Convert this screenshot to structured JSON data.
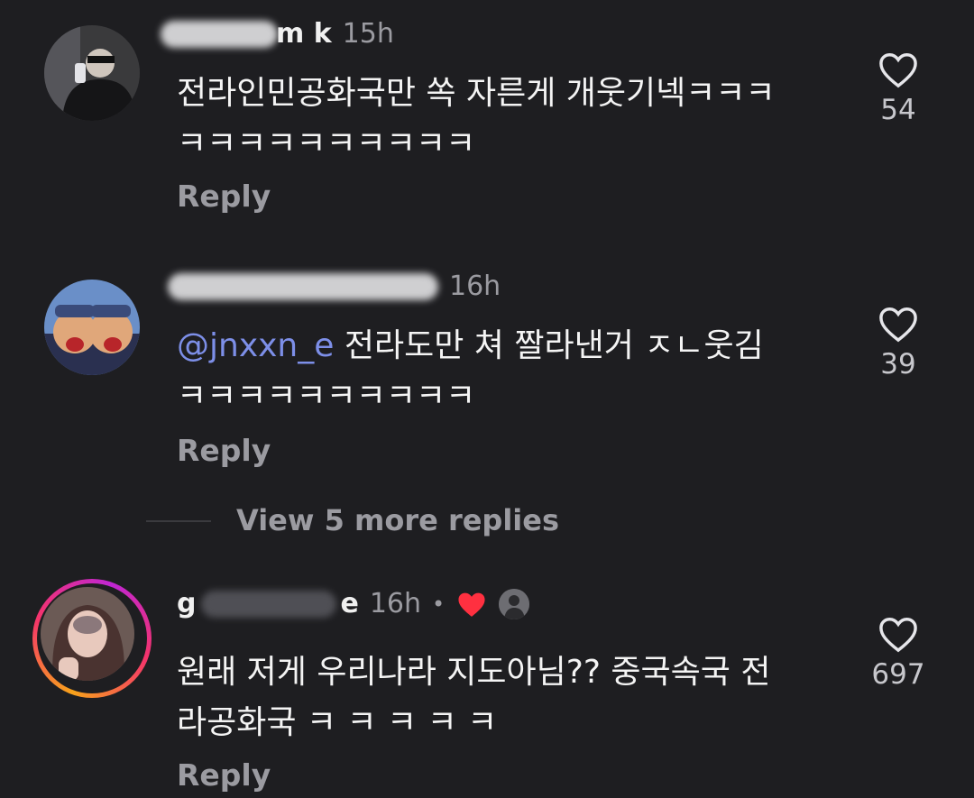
{
  "comments": [
    {
      "username": "m k",
      "time": "15h",
      "text_line1": "전라인민공화국만 쏙 자른게 개웃기넥ㅋㅋㅋ",
      "text_line2": "ㅋㅋㅋㅋㅋㅋㅋㅋㅋㅋ",
      "reply": "Reply",
      "likes": "54"
    },
    {
      "username": "",
      "time": "16h",
      "mention": "@jnxxn_e",
      "text_line1": "전라도만 쳐 짤라낸거 ㅈㄴ웃김",
      "text_line2": "ㅋㅋㅋㅋㅋㅋㅋㅋㅋㅋ",
      "reply": "Reply",
      "likes": "39"
    },
    {
      "username_start": "g",
      "username_end": "e",
      "time": "16h",
      "separator": "•",
      "text_line1": "원래 저게 우리나라 지도아님?? 중국속국 전",
      "text_line2": "라공화국 ㅋ ㅋ ㅋ ㅋ ㅋ",
      "reply": "Reply",
      "likes": "697"
    }
  ],
  "view_more": "View 5 more replies",
  "colors": {
    "background": "#1e1e21",
    "mention": "#7d8fe8",
    "heart_red": "#ff3040",
    "muted": "#9b9ba1"
  }
}
